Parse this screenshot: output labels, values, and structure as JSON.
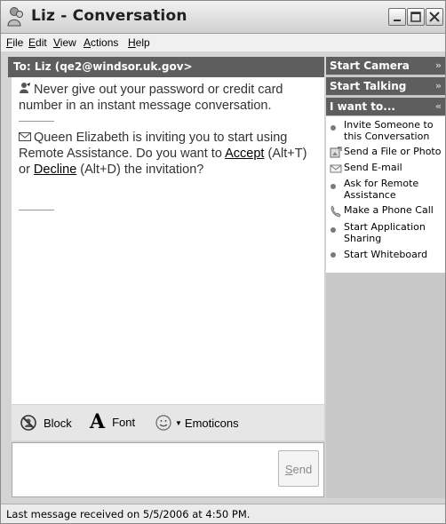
{
  "window": {
    "title": "Liz - Conversation"
  },
  "menu": [
    {
      "pre": "",
      "acc": "F",
      "post": "ile"
    },
    {
      "pre": "",
      "acc": "E",
      "post": "dit"
    },
    {
      "pre": "",
      "acc": "V",
      "post": "iew"
    },
    {
      "pre": "",
      "acc": "A",
      "post": "ctions"
    },
    {
      "pre": "",
      "acc": "H",
      "post": "elp"
    }
  ],
  "to_bar": {
    "text": "To:  Liz (qe2@windsor.uk.gov>"
  },
  "messages": {
    "warning": "Never give out your password or credit card number in an instant message conversation.",
    "invite_text": "Queen Elizabeth is inviting you to start using Remote Assistance. Do you want to ",
    "accept_label": "Accept",
    "accept_shortcut": " (Alt+T) or ",
    "decline_label": "Decline",
    "decline_shortcut": " (Alt+D) the invitation?"
  },
  "toolbar": {
    "block": "Block",
    "font": "Font",
    "emoticons": "Emoticons",
    "send": "Send"
  },
  "sidebar": {
    "sections": [
      {
        "label": "Start Camera",
        "state": "collapsed"
      },
      {
        "label": "Start Talking",
        "state": "collapsed"
      },
      {
        "label": "I want to...",
        "state": "expanded"
      }
    ],
    "tasks": [
      {
        "label": "Invite Someone to this Conversation",
        "icon": "invite-icon"
      },
      {
        "label": "Send a File or Photo",
        "icon": "send-file-icon"
      },
      {
        "label": "Send E-mail",
        "icon": "email-icon"
      },
      {
        "label": "Ask for Remote Assistance",
        "icon": "remote-assistance-icon"
      },
      {
        "label": "Make a Phone Call",
        "icon": "phone-icon"
      },
      {
        "label": "Start Application Sharing",
        "icon": "app-sharing-icon"
      },
      {
        "label": "Start Whiteboard",
        "icon": "whiteboard-icon"
      }
    ]
  },
  "status": {
    "text": "Last message received on 5/5/2006 at 4:50 PM."
  }
}
